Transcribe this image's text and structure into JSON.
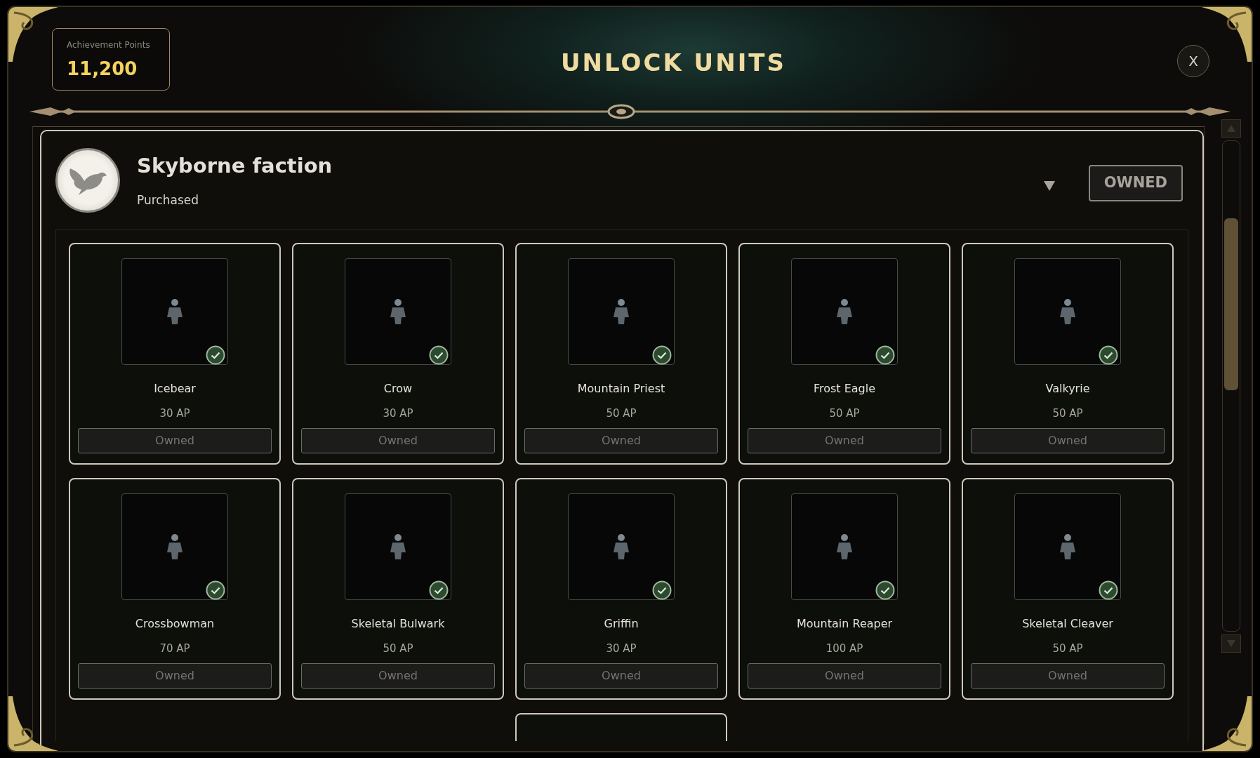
{
  "header": {
    "points_label": "Achievement Points",
    "points_value": "11,200",
    "title": "UNLOCK UNITS",
    "close": "X"
  },
  "faction": {
    "name": "Skyborne faction",
    "status": "Purchased",
    "expanded": true,
    "button": "OWNED",
    "owned": true
  },
  "units": [
    {
      "name": "Icebear",
      "price": "30 AP",
      "button": "Owned",
      "owned": true
    },
    {
      "name": "Crow",
      "price": "30 AP",
      "button": "Owned",
      "owned": true
    },
    {
      "name": "Mountain Priest",
      "price": "50 AP",
      "button": "Owned",
      "owned": true
    },
    {
      "name": "Frost Eagle",
      "price": "50 AP",
      "button": "Owned",
      "owned": true
    },
    {
      "name": "Valkyrie",
      "price": "50 AP",
      "button": "Owned",
      "owned": true
    },
    {
      "name": "Crossbowman",
      "price": "70 AP",
      "button": "Owned",
      "owned": true
    },
    {
      "name": "Skeletal Bulwark",
      "price": "50 AP",
      "button": "Owned",
      "owned": true
    },
    {
      "name": "Griffin",
      "price": "30 AP",
      "button": "Owned",
      "owned": true
    },
    {
      "name": "Mountain Reaper",
      "price": "100 AP",
      "button": "Owned",
      "owned": true
    },
    {
      "name": "Skeletal Cleaver",
      "price": "50 AP",
      "button": "Owned",
      "owned": true
    }
  ]
}
